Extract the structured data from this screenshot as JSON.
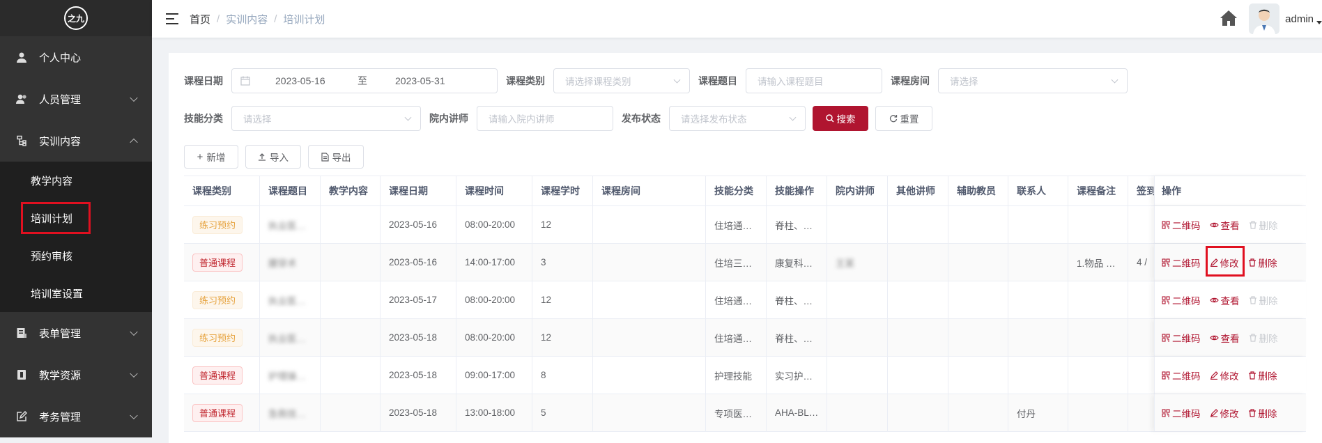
{
  "sidebar": {
    "logo_text": "之九",
    "items": [
      {
        "label": "个人中心",
        "icon": "user-icon"
      },
      {
        "label": "人员管理",
        "icon": "people-icon"
      },
      {
        "label": "实训内容",
        "icon": "tree-icon"
      },
      {
        "label": "表单管理",
        "icon": "form-icon"
      },
      {
        "label": "教学资源",
        "icon": "book-icon"
      },
      {
        "label": "考务管理",
        "icon": "edit-icon"
      }
    ],
    "submenu": [
      {
        "label": "教学内容"
      },
      {
        "label": "培训计划"
      },
      {
        "label": "预约审核"
      },
      {
        "label": "培训室设置"
      }
    ]
  },
  "navbar": {
    "breadcrumb": [
      "首页",
      "实训内容",
      "培训计划"
    ],
    "separator": "/",
    "username": "admin"
  },
  "filters": {
    "date_label": "课程日期",
    "date_start": "2023-05-16",
    "date_to": "至",
    "date_end": "2023-05-31",
    "category_label": "课程类别",
    "category_placeholder": "请选择课程类别",
    "topic_label": "课程题目",
    "topic_placeholder": "请输入课程题目",
    "room_label": "课程房间",
    "room_placeholder": "请选择",
    "skill_label": "技能分类",
    "skill_placeholder": "请选择",
    "lecturer_label": "院内讲师",
    "lecturer_placeholder": "请输入院内讲师",
    "status_label": "发布状态",
    "status_placeholder": "请选择发布状态",
    "search_label": "搜索",
    "reset_label": "重置"
  },
  "toolbar": {
    "add_label": "新增",
    "import_label": "导入",
    "export_label": "导出"
  },
  "table": {
    "headers": [
      "课程类别",
      "课程题目",
      "教学内容",
      "课程日期",
      "课程时间",
      "课程学时",
      "课程房间",
      "技能分类",
      "技能操作",
      "院内讲师",
      "其他讲师",
      "辅助教员",
      "联系人",
      "课程备注",
      "签到",
      "操作"
    ],
    "rows": [
      {
        "type": "练习预约",
        "type_style": "orange",
        "title": "执业医…",
        "content": "",
        "date": "2023-05-16",
        "time": "08:00-20:00",
        "hours": "12",
        "room": "",
        "skill": "住培通…",
        "op": "脊柱、…",
        "lecturer": "",
        "other": "",
        "assist": "",
        "contact": "",
        "note": "",
        "sign": "",
        "actions": [
          "二维码",
          "查看",
          "删除"
        ],
        "delete_enabled": false
      },
      {
        "type": "普通课程",
        "type_style": "red",
        "title": "腰穿术",
        "content": "",
        "date": "2023-05-16",
        "time": "14:00-17:00",
        "hours": "3",
        "room": "",
        "skill": "住培三…",
        "op": "康复科…",
        "lecturer": "王某",
        "other": "",
        "assist": "",
        "contact": "",
        "note": "1.物品 …",
        "sign": "4 /",
        "actions": [
          "二维码",
          "修改",
          "删除"
        ],
        "delete_enabled": true
      },
      {
        "type": "练习预约",
        "type_style": "orange",
        "title": "执业医…",
        "content": "",
        "date": "2023-05-17",
        "time": "08:00-20:00",
        "hours": "12",
        "room": "",
        "skill": "住培通…",
        "op": "脊柱、…",
        "lecturer": "",
        "other": "",
        "assist": "",
        "contact": "",
        "note": "",
        "sign": "",
        "actions": [
          "二维码",
          "查看",
          "删除"
        ],
        "delete_enabled": false
      },
      {
        "type": "练习预约",
        "type_style": "orange",
        "title": "执业医…",
        "content": "",
        "date": "2023-05-18",
        "time": "08:00-20:00",
        "hours": "12",
        "room": "",
        "skill": "住培通…",
        "op": "脊柱、…",
        "lecturer": "",
        "other": "",
        "assist": "",
        "contact": "",
        "note": "",
        "sign": "",
        "actions": [
          "二维码",
          "查看",
          "删除"
        ],
        "delete_enabled": false
      },
      {
        "type": "普通课程",
        "type_style": "red",
        "title": "护理操…",
        "content": "",
        "date": "2023-05-18",
        "time": "09:00-17:00",
        "hours": "8",
        "room": "",
        "skill": "护理技能",
        "op": "实习护…",
        "lecturer": "",
        "other": "",
        "assist": "",
        "contact": "",
        "note": "",
        "sign": "",
        "actions": [
          "二维码",
          "修改",
          "删除"
        ],
        "delete_enabled": true
      },
      {
        "type": "普通课程",
        "type_style": "red",
        "title": "急救技…",
        "content": "",
        "date": "2023-05-18",
        "time": "13:00-18:00",
        "hours": "5",
        "room": "",
        "skill": "专项医…",
        "op": "AHA-BL…",
        "lecturer": "",
        "other": "",
        "assist": "",
        "contact": "付丹",
        "note": "",
        "sign": "",
        "actions": [
          "二维码",
          "修改",
          "删除"
        ],
        "delete_enabled": true
      }
    ]
  },
  "colors": {
    "accent": "#b01530",
    "sidebar_bg": "#333333",
    "highlight": "#e01020"
  }
}
